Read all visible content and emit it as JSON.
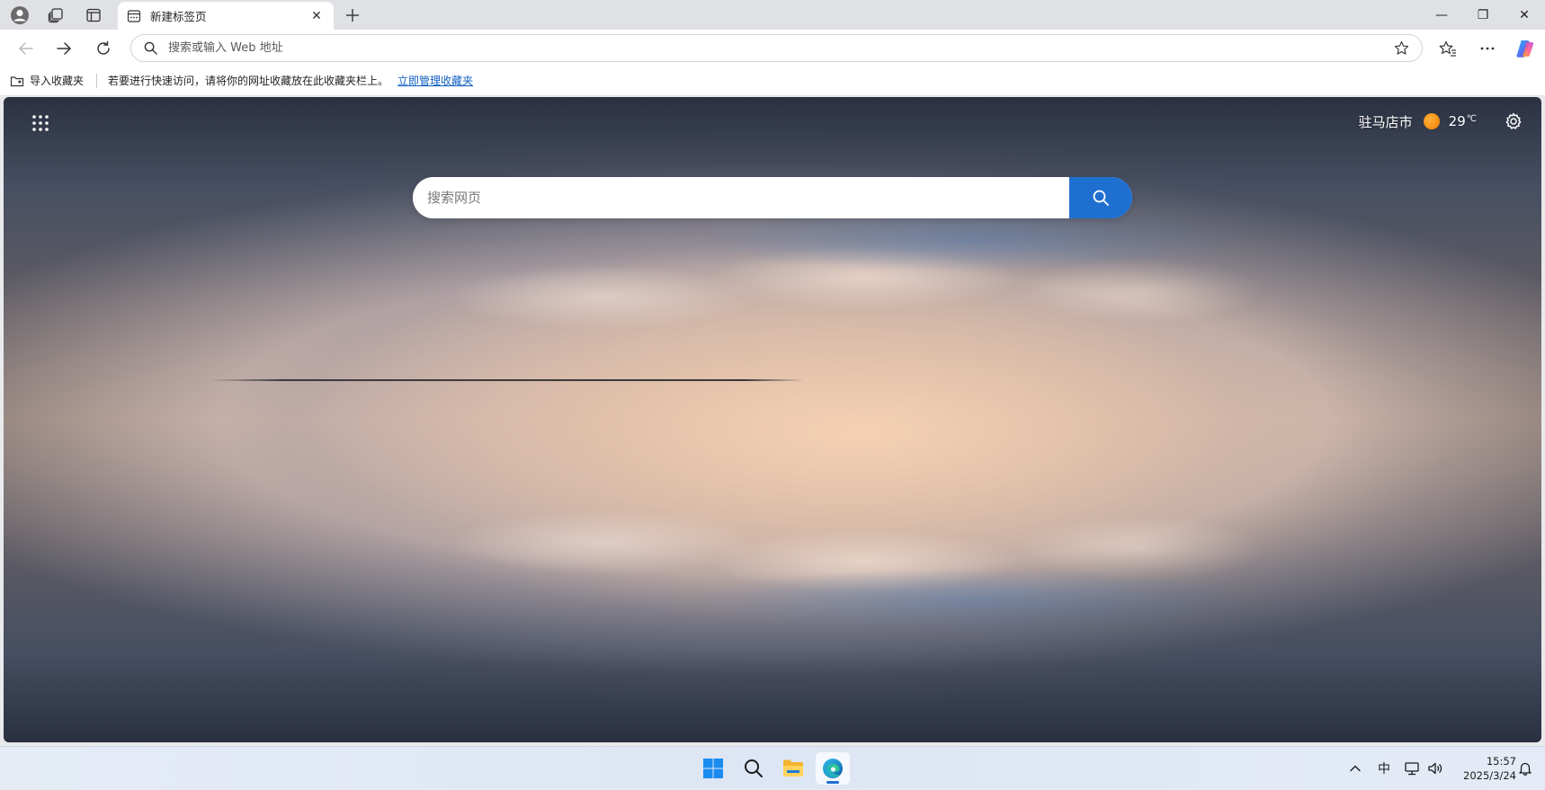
{
  "tab": {
    "title": "新建标签页",
    "close": "✕"
  },
  "window_controls": {
    "minimize": "—",
    "restore": "❐",
    "close": "✕"
  },
  "address_bar": {
    "placeholder": "搜索或输入 Web 地址"
  },
  "favorites_bar": {
    "import_label": "导入收藏夹",
    "hint": "若要进行快速访问，请将你的网址收藏放在此收藏夹栏上。",
    "manage_link": "立即管理收藏夹"
  },
  "new_tab_page": {
    "weather": {
      "city": "驻马店市",
      "temperature": "29",
      "unit": "℃"
    },
    "search": {
      "placeholder": "搜索网页"
    }
  },
  "taskbar": {
    "ime": "中",
    "clock": {
      "time": "15:57",
      "date": "2025/3/24"
    }
  },
  "colors": {
    "accent": "#1f6fd0",
    "link": "#0f5fc2",
    "weather_sun": "#f08a00"
  }
}
